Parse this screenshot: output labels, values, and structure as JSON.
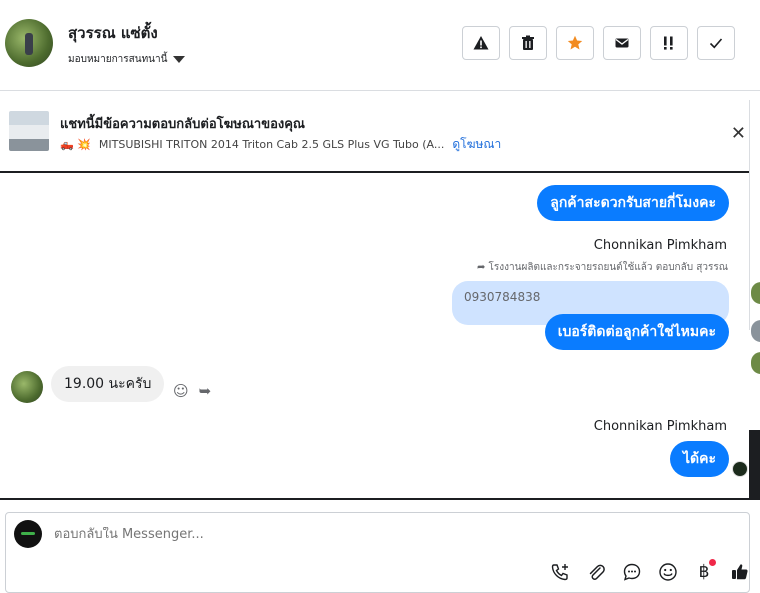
{
  "header": {
    "contact_name": "สุวรรณ แซ่ตั้ง",
    "assign_label": "มอบหมายการสนทนานี้",
    "tools": [
      "warning-icon",
      "trash-icon",
      "star-icon",
      "mail-icon",
      "priority-icon",
      "check-icon"
    ],
    "star_color": "#f28b20"
  },
  "ad": {
    "title": "แชทนี้มีข้อความตอบกลับต่อโฆษณาของคุณ",
    "emojis": "🛻 💥",
    "subtitle": "MITSUBISHI TRITON 2014 Triton Cab 2.5 GLS Plus VG Tubo (A...",
    "link": "ดูโฆษณา"
  },
  "messages": {
    "out1": "ลูกค้าสะดวกรับสายกี่โมงคะ",
    "sender1": "Chonnikan Pimkham",
    "reply_note": "โรงงานผลิตและกระจายรถยนต์ใช้แล้ว ตอบกลับ สุวรรณ",
    "quoted": "0930784838",
    "out2": "เบอร์ติดต่อลูกค้าใช่ไหมคะ",
    "in1": "19.00 นะครับ",
    "sender2": "Chonnikan Pimkham",
    "out3": "ได้คะ"
  },
  "composer": {
    "placeholder": "ตอบกลับใน Messenger...",
    "icons": [
      "call-add-icon",
      "attachment-icon",
      "saved-reply-icon",
      "emoji-icon",
      "baht-icon",
      "like-icon"
    ]
  },
  "colors": {
    "bubble_out": "#0a7cff",
    "bubble_in": "#f0f0f0",
    "quoted_bg": "#cfe3ff",
    "link": "#216fdb"
  }
}
